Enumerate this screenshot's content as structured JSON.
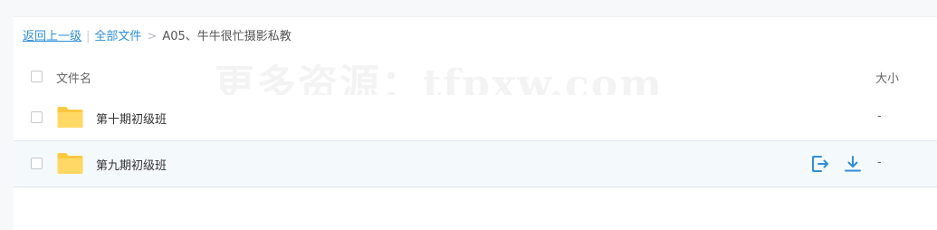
{
  "breadcrumb": {
    "back_label": "返回上一级",
    "separator_bar": "|",
    "all_files_label": "全部文件",
    "separator_gt": ">",
    "current_folder": "A05、牛牛很忙摄影私教"
  },
  "watermark": {
    "text": "更多资源：tfpxw.com"
  },
  "table": {
    "header": {
      "name_label": "文件名",
      "size_label": "大小"
    },
    "rows": [
      {
        "name": "第十期初级班",
        "size": "-",
        "icon": "folder-icon",
        "hovered": false
      },
      {
        "name": "第九期初级班",
        "size": "-",
        "icon": "folder-icon",
        "hovered": true,
        "actions": [
          "share-icon",
          "download-icon"
        ]
      }
    ]
  },
  "colors": {
    "accent": "#2e8fd8",
    "folder": "#ffd15c",
    "hover_row": "#f4f9fc"
  }
}
